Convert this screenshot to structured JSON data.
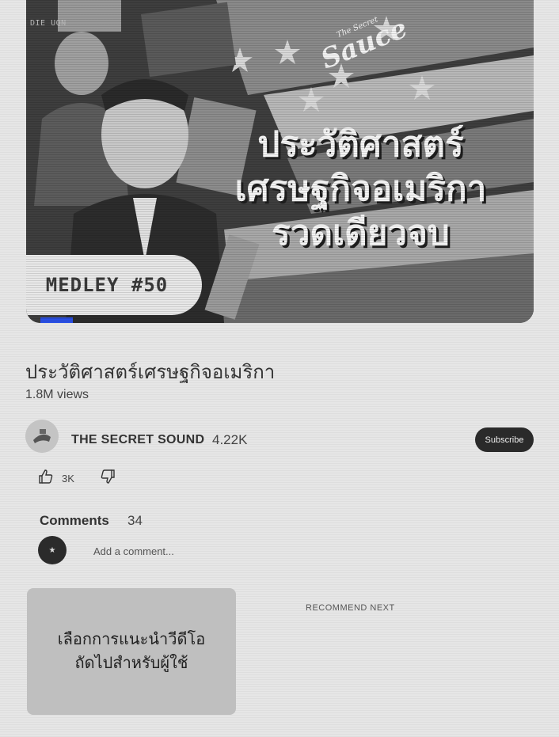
{
  "thumbnail": {
    "corner_text": "DIE UQN",
    "logo_small": "The Secret",
    "logo_big": "Sauce",
    "headline_lines": [
      "ประวัติศาสตร์",
      "เศรษฐกิจอเมริกา",
      "รวดเดียวจบ"
    ],
    "badge": "MEDLEY #50",
    "watch_progress": 0.066,
    "colors": {
      "progress": "#2a50e6"
    }
  },
  "video": {
    "title": "ประวัติศาสตร์เศรษฐกิจอเมริกา",
    "views": "1.8M views"
  },
  "channel": {
    "name": "THE SECRET SOUND",
    "subscribers": "4.22K",
    "subscribe_label": "Subscribe"
  },
  "actions": {
    "like_count": "3K",
    "like_icon": "thumb-up-icon",
    "dislike_icon": "thumb-down-icon"
  },
  "comments": {
    "label": "Comments",
    "count": "34",
    "placeholder": "Add a comment..."
  },
  "recommend": {
    "box_line1": "เลือกการแนะนำวีดีโอ",
    "box_line2": "ถัดไปสำหรับผู้ใช้",
    "next_label": "RECOMMEND NEXT"
  }
}
